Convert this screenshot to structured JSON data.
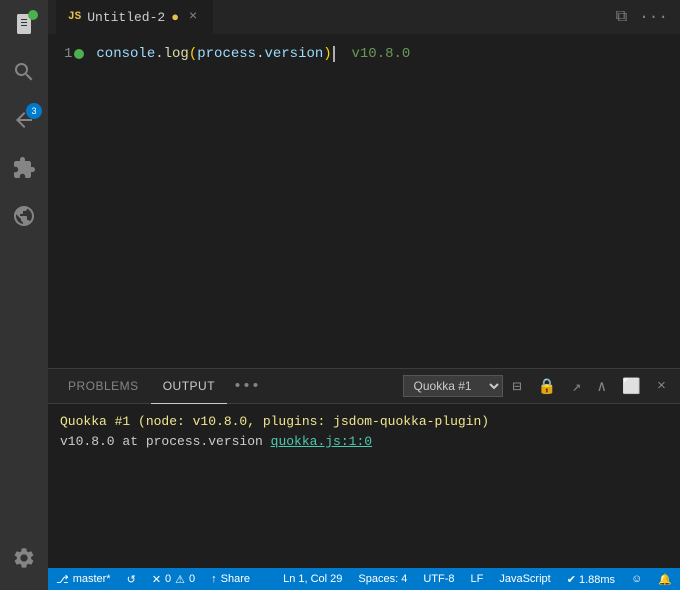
{
  "activityBar": {
    "icons": [
      {
        "name": "explorer-icon",
        "symbol": "⬡",
        "active": false,
        "badge": null
      },
      {
        "name": "search-icon",
        "symbol": "🔍",
        "active": false,
        "badge": null
      },
      {
        "name": "source-control-icon",
        "symbol": "⎇",
        "active": false,
        "badge": "3"
      },
      {
        "name": "extensions-icon",
        "symbol": "⊞",
        "active": false,
        "badge": null
      },
      {
        "name": "remote-icon",
        "symbol": "☁",
        "active": false,
        "badge": null
      }
    ],
    "bottomIcons": [
      {
        "name": "settings-icon",
        "symbol": "⚙",
        "active": false
      }
    ]
  },
  "titleBar": {
    "tab": {
      "icon": "JS",
      "label": "Untitled-2",
      "dirty": true
    }
  },
  "editor": {
    "lines": [
      {
        "number": "1",
        "hasDot": true,
        "code": "console.log(process.version)",
        "result": "v10.8.0"
      }
    ]
  },
  "panel": {
    "tabs": [
      {
        "label": "PROBLEMS",
        "active": false
      },
      {
        "label": "OUTPUT",
        "active": true
      }
    ],
    "moreLabel": "•••",
    "dropdownValue": "Quokka #1",
    "output": {
      "line1": "Quokka #1 (node: v10.8.0, plugins: jsdom-quokka-plugin)",
      "line2prefix": "v10.8.0 at process.version ",
      "line2link": "quokka.js:1:0"
    }
  },
  "statusBar": {
    "branch": "master*",
    "syncIcon": "↺",
    "errors": "0",
    "warnings": "0",
    "position": "Ln 1, Col 29",
    "spaces": "Spaces: 4",
    "encoding": "UTF-8",
    "lineEnding": "LF",
    "language": "JavaScript",
    "quokkaResult": "✔ 1.88ms",
    "feedbackIcon": "☺",
    "bellIcon": "🔔"
  }
}
